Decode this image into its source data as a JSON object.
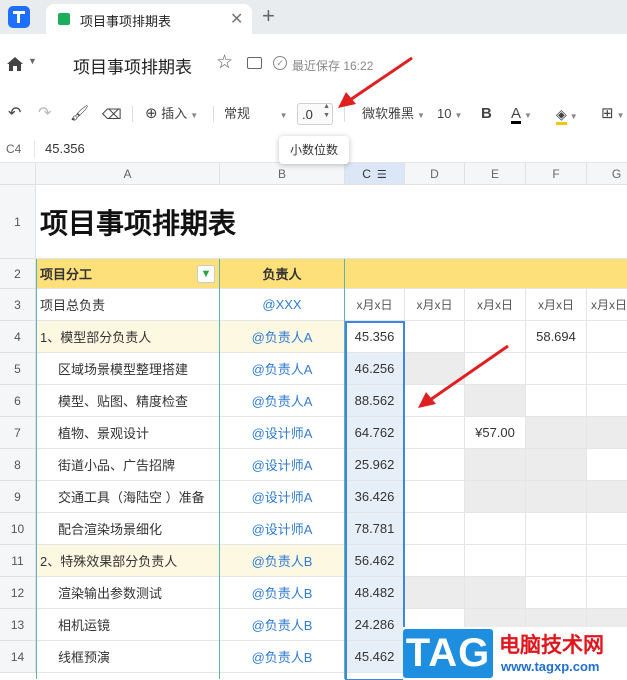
{
  "browser_tab": {
    "title": "项目事项排期表"
  },
  "header": {
    "doc_title": "项目事项排期表",
    "save_status": "最近保存 16:22"
  },
  "toolbar": {
    "insert_label": "插入",
    "format_label": "常规",
    "decimal_label": ".0",
    "font_label": "微软雅黑",
    "font_size": "10",
    "bold_label": "B",
    "text_color_label": "A"
  },
  "tooltip": {
    "text": "小数位数"
  },
  "formula_bar": {
    "cell_ref": "C4",
    "value": "45.356"
  },
  "columns": [
    "A",
    "B",
    "C",
    "D",
    "E",
    "F",
    "G"
  ],
  "rows": {
    "r1": {
      "num": "1",
      "title": "项目事项排期表"
    },
    "r2": {
      "num": "2",
      "a": "项目分工",
      "b": "负责人"
    },
    "r3": {
      "num": "3",
      "a": "项目总负责",
      "b": "@XXX",
      "c": "x月x日",
      "d": "x月x日",
      "e": "x月x日",
      "f": "x月x日",
      "g": "x月x日"
    },
    "r4": {
      "num": "4",
      "a": "1、模型部分负责人",
      "b": "@负责人A",
      "c": "45.356",
      "f": "58.694"
    },
    "r5": {
      "num": "5",
      "a": "区域场景模型整理搭建",
      "b": "@负责人A",
      "c": "46.256"
    },
    "r6": {
      "num": "6",
      "a": "模型、贴图、精度检查",
      "b": "@负责人A",
      "c": "88.562"
    },
    "r7": {
      "num": "7",
      "a": "植物、景观设计",
      "b": "@设计师A",
      "c": "64.762",
      "e": "¥57.00"
    },
    "r8": {
      "num": "8",
      "a": "街道小品、广告招牌",
      "b": "@设计师A",
      "c": "25.962"
    },
    "r9": {
      "num": "9",
      "a": "交通工具（海陆空 ）准备",
      "b": "@设计师A",
      "c": "36.426"
    },
    "r10": {
      "num": "10",
      "a": "配合渲染场景细化",
      "b": "@设计师A",
      "c": "78.781"
    },
    "r11": {
      "num": "11",
      "a": "2、特殊效果部分负责人",
      "b": "@负责人B",
      "c": "56.462"
    },
    "r12": {
      "num": "12",
      "a": "渲染输出参数测试",
      "b": "@负责人B",
      "c": "48.482"
    },
    "r13": {
      "num": "13",
      "a": "相机运镜",
      "b": "@负责人B",
      "c": "24.286"
    },
    "r14": {
      "num": "14",
      "a": "线框预演",
      "b": "@负责人B",
      "c": "45.462"
    }
  },
  "watermark": {
    "logo": "TAG",
    "site": "电脑技术网",
    "url": "www.tagxp.com"
  },
  "colors": {
    "accent": "#3e86e0",
    "header_yellow": "#fde07a",
    "section_yellow": "#fdf8e1",
    "arrow_red": "#e02020",
    "link_blue": "#2f7bd6"
  }
}
